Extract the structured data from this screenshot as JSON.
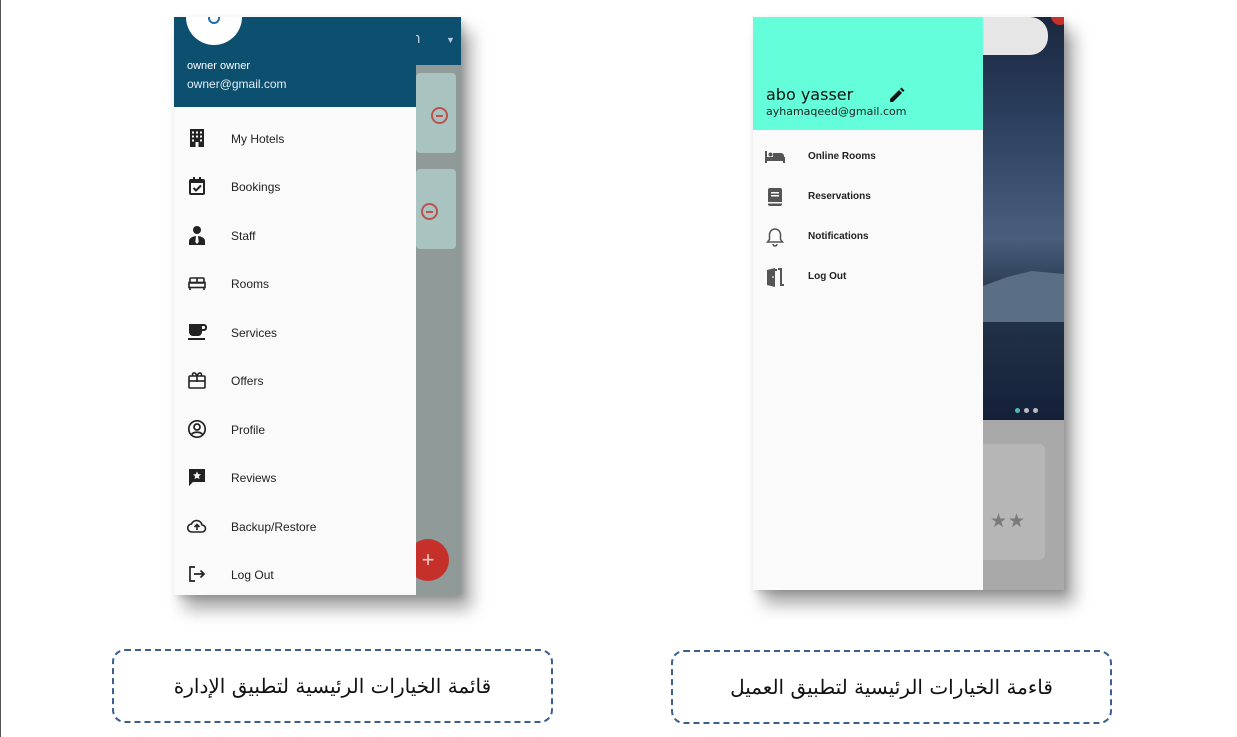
{
  "admin_app": {
    "user": {
      "name": "owner owner",
      "email": "owner@gmail.com"
    },
    "background_topbar_text": "n",
    "fab_label": "+",
    "menu": [
      {
        "label": "My Hotels",
        "icon": "hotel-icon"
      },
      {
        "label": "Bookings",
        "icon": "calendar-check-icon"
      },
      {
        "label": "Staff",
        "icon": "person-tie-icon"
      },
      {
        "label": "Rooms",
        "icon": "bed-icon"
      },
      {
        "label": "Services",
        "icon": "coffee-cup-icon"
      },
      {
        "label": "Offers",
        "icon": "gift-card-icon"
      },
      {
        "label": "Profile",
        "icon": "account-circle-icon"
      },
      {
        "label": "Reviews",
        "icon": "rate-review-icon"
      },
      {
        "label": "Backup/Restore",
        "icon": "cloud-upload-icon"
      },
      {
        "label": "Log Out",
        "icon": "logout-icon"
      }
    ],
    "colors": {
      "header": "#0d4f6f",
      "fab": "#c6302b"
    }
  },
  "client_app": {
    "user": {
      "name": "abo yasser",
      "email": "ayhamaqeed@gmail.com"
    },
    "menu": [
      {
        "label": "Online Rooms",
        "icon": "bed-icon"
      },
      {
        "label": "Reservations",
        "icon": "book-icon"
      },
      {
        "label": "Notifications",
        "icon": "bell-icon"
      },
      {
        "label": "Log Out",
        "icon": "door-exit-icon"
      }
    ],
    "stars": "★★",
    "colors": {
      "header": "#64ffda"
    }
  },
  "captions": {
    "admin": "قائمة الخيارات الرئيسية لتطبيق الإدارة",
    "client": "قاءمة الخيارات الرئيسية لتطبيق العميل"
  }
}
